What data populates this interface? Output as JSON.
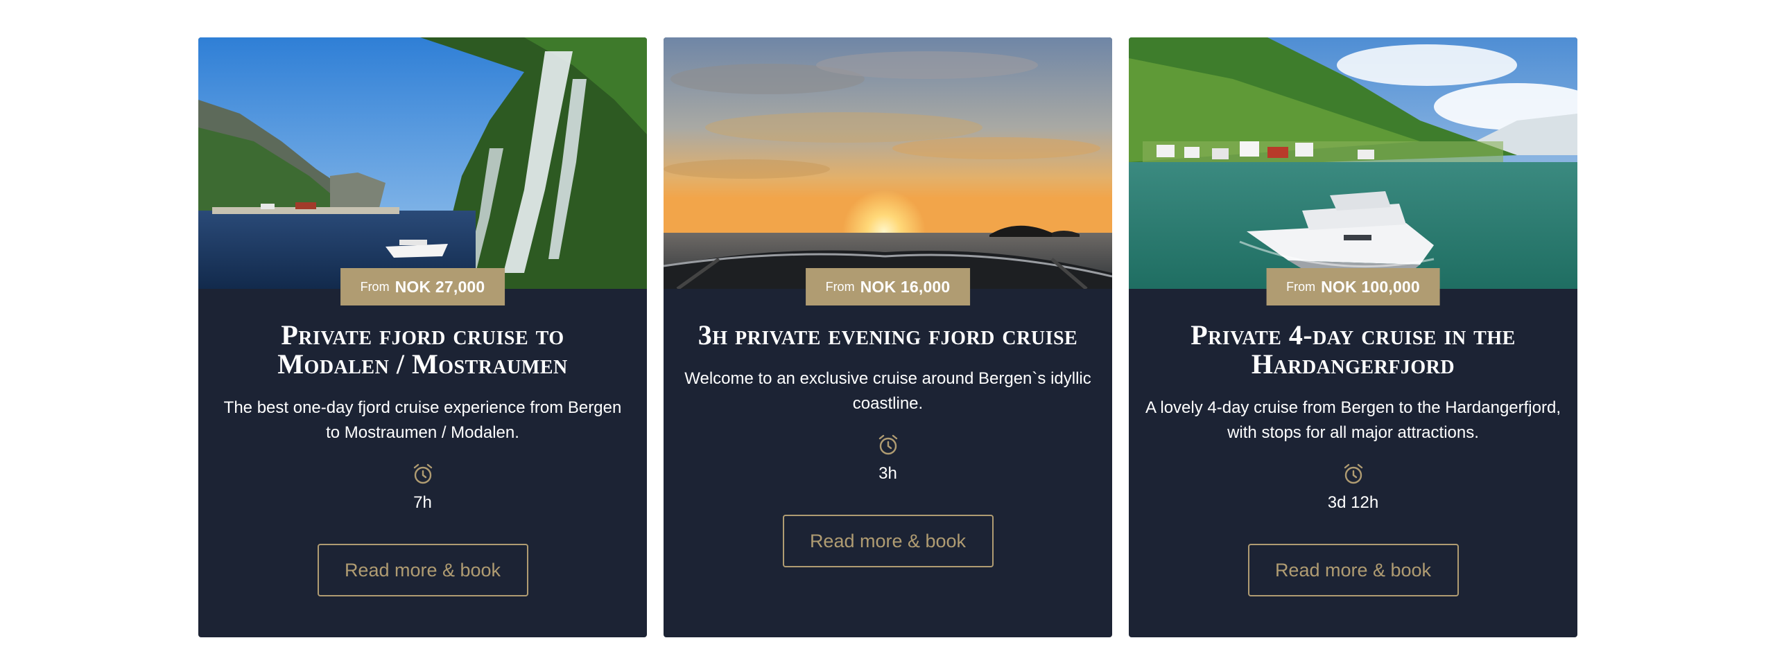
{
  "cards": [
    {
      "image": "fjord-waterfall-yacht",
      "price_from": "From",
      "price_amount": "NOK 27,000",
      "title": "Private fjord cruise to Modalen / Mostraumen",
      "description": "The best one-day fjord cruise experience from Bergen to Mostraumen / Modalen.",
      "duration_icon": "alarm-clock-icon",
      "duration": "7h",
      "button_label": "Read more & book"
    },
    {
      "image": "sunset-from-boat-bow",
      "price_from": "From",
      "price_amount": "NOK 16,000",
      "title": "3h private evening fjord cruise",
      "description": "Welcome to an exclusive cruise around Bergen`s idyllic coastline.",
      "duration_icon": "alarm-clock-icon",
      "duration": "3h",
      "button_label": "Read more & book"
    },
    {
      "image": "yacht-in-hardangerfjord",
      "price_from": "From",
      "price_amount": "NOK 100,000",
      "title": "Private 4-day cruise in the Hardangerfjord",
      "description": "A lovely 4-day cruise from Bergen to the Hardangerfjord, with stops for all major attractions.",
      "duration_icon": "alarm-clock-icon",
      "duration": "3d 12h",
      "button_label": "Read more & book"
    }
  ],
  "colors": {
    "card_background": "#1c2334",
    "accent_gold": "#b09c72",
    "text": "#ffffff"
  }
}
